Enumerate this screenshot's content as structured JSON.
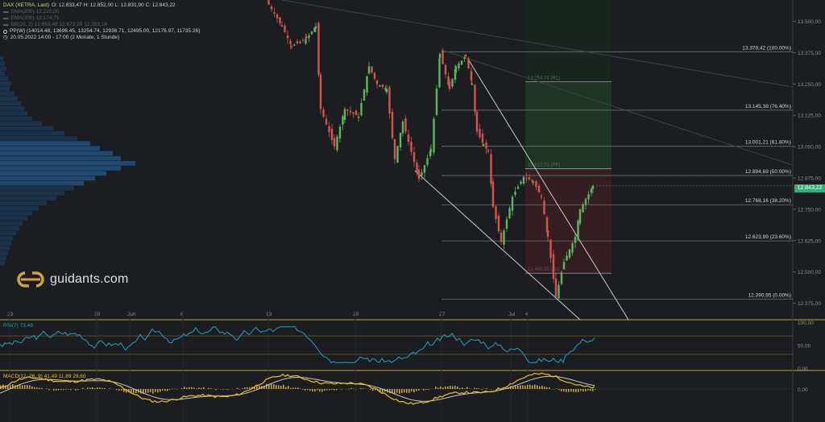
{
  "legend": {
    "instrument": "DAX (XETRA, Last)",
    "ohlc": "O: 12.833,47  H: 12.852,00  L: 12.831,90  C: 12.843,22",
    "sma200": "SMA(200)  13.229,00",
    "ema200": "EMA(200)  13.174,71",
    "bb": "BB(20, 2)  12.953,48  12.673,25  12.393,16",
    "pp": "PP(W)  (14014.48, 13696.45, 13254.74, 12936.71, 12495.00, 12176.97, 11735.26)",
    "period": "20.05.2022 14:00 - 17:00  (2 Monate, 1 Stunde)"
  },
  "brand": {
    "name": "guidants.com",
    "logo_icon": "guidants-logo-icon"
  },
  "current_price": "12.843,22",
  "colors": {
    "up": "#5cb85c",
    "down": "#d9534f",
    "rsi": "#1aa3c8",
    "macd": "#f2c014",
    "signal": "#c5c8cc",
    "price_tag": "#2fb07a"
  },
  "chart_data": [
    {
      "type": "candlestick",
      "title": "DAX (XETRA, Last)",
      "x_ticks": [
        "23",
        "30",
        "Jun",
        "6",
        "13",
        "20",
        "27",
        "Jul",
        "4"
      ],
      "y_ticks": [
        "13.500,00",
        "13.375,00",
        "13.250,00",
        "13.125,00",
        "13.000,00",
        "12.875,00",
        "12.750,00",
        "12.625,00",
        "12.500,00",
        "12.375,00"
      ],
      "ylim": [
        12348,
        13585
      ],
      "fibonacci": [
        {
          "label": "13.378,42 (100.00%)",
          "value": 13378.42
        },
        {
          "label": "13.145,38 (76.40%)",
          "value": 13145.38
        },
        {
          "label": "13.001,21 (61.80%)",
          "value": 13001.21
        },
        {
          "label": "12.884,69 (50.00%)",
          "value": 12884.69
        },
        {
          "label": "12.768,16 (38.20%)",
          "value": 12768.16
        },
        {
          "label": "12.623,99 (23.60%)",
          "value": 12623.99
        },
        {
          "label": "12.390,95 (0.00%)",
          "value": 12390.95
        }
      ],
      "position_box": {
        "entry": 12912,
        "target": 13259,
        "stop": 12495,
        "entry_label": "12.912,71 (PP)",
        "target_label": "13.254,74 (R1)",
        "stop_label": "12.495,00 (S1)"
      },
      "last_price": 12843.22
    },
    {
      "type": "line",
      "title": "RSI(7)",
      "value_label": "73,48",
      "y_ticks": [
        "100,00",
        "50,00",
        "0,00"
      ],
      "ylim": [
        0,
        100
      ],
      "levels": [
        70,
        30
      ]
    },
    {
      "type": "bar",
      "title": "MACD(12, 26, 9)",
      "value_label": "41,49  11,89  29,60",
      "y_ticks": [
        "0,00"
      ]
    }
  ]
}
